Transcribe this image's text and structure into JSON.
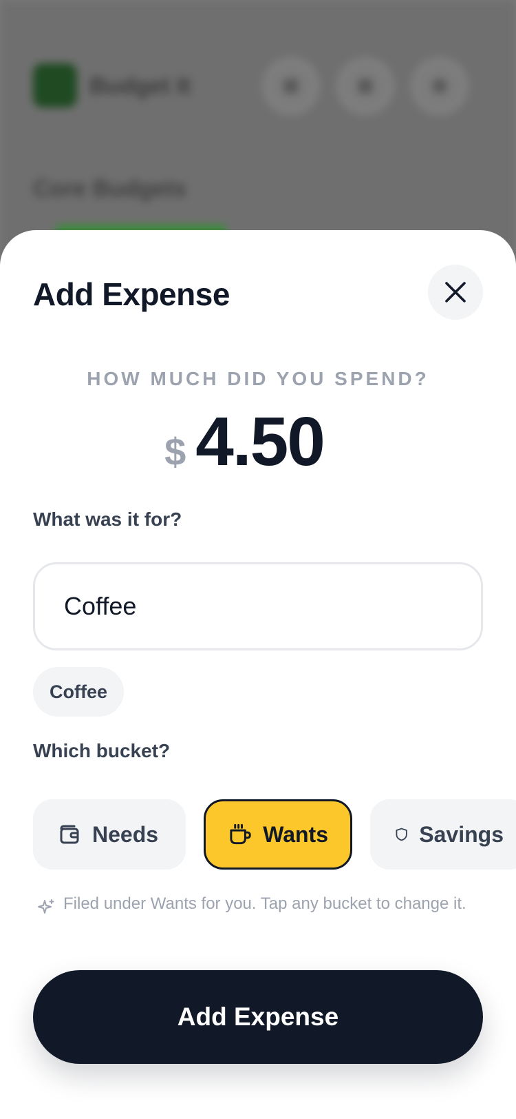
{
  "background": {
    "app_title": "Budget It",
    "section_title": "Core Budgets"
  },
  "sheet": {
    "title": "Add Expense",
    "close_icon": "close-icon"
  },
  "amount": {
    "label": "HOW MUCH DID YOU SPEND?",
    "currency": "$",
    "value": "4.50"
  },
  "description": {
    "label": "What was it for?",
    "value": "Coffee",
    "suggestions": [
      "Coffee"
    ]
  },
  "bucket": {
    "label": "Which bucket?",
    "options": [
      {
        "label": "Needs",
        "icon": "wallet-icon",
        "selected": false
      },
      {
        "label": "Wants",
        "icon": "coffee-cup-icon",
        "selected": true
      },
      {
        "label": "Savings",
        "icon": "shield-icon",
        "selected": false
      }
    ],
    "hint": "Filed under Wants for you. Tap any bucket to change it.",
    "hint_icon": "sparkle-icon"
  },
  "submit": {
    "label": "Add Expense"
  },
  "colors": {
    "primary": "#111827",
    "accent": "#FBC72A",
    "muted": "#9CA3AF",
    "chip_bg": "#F3F4F6"
  }
}
